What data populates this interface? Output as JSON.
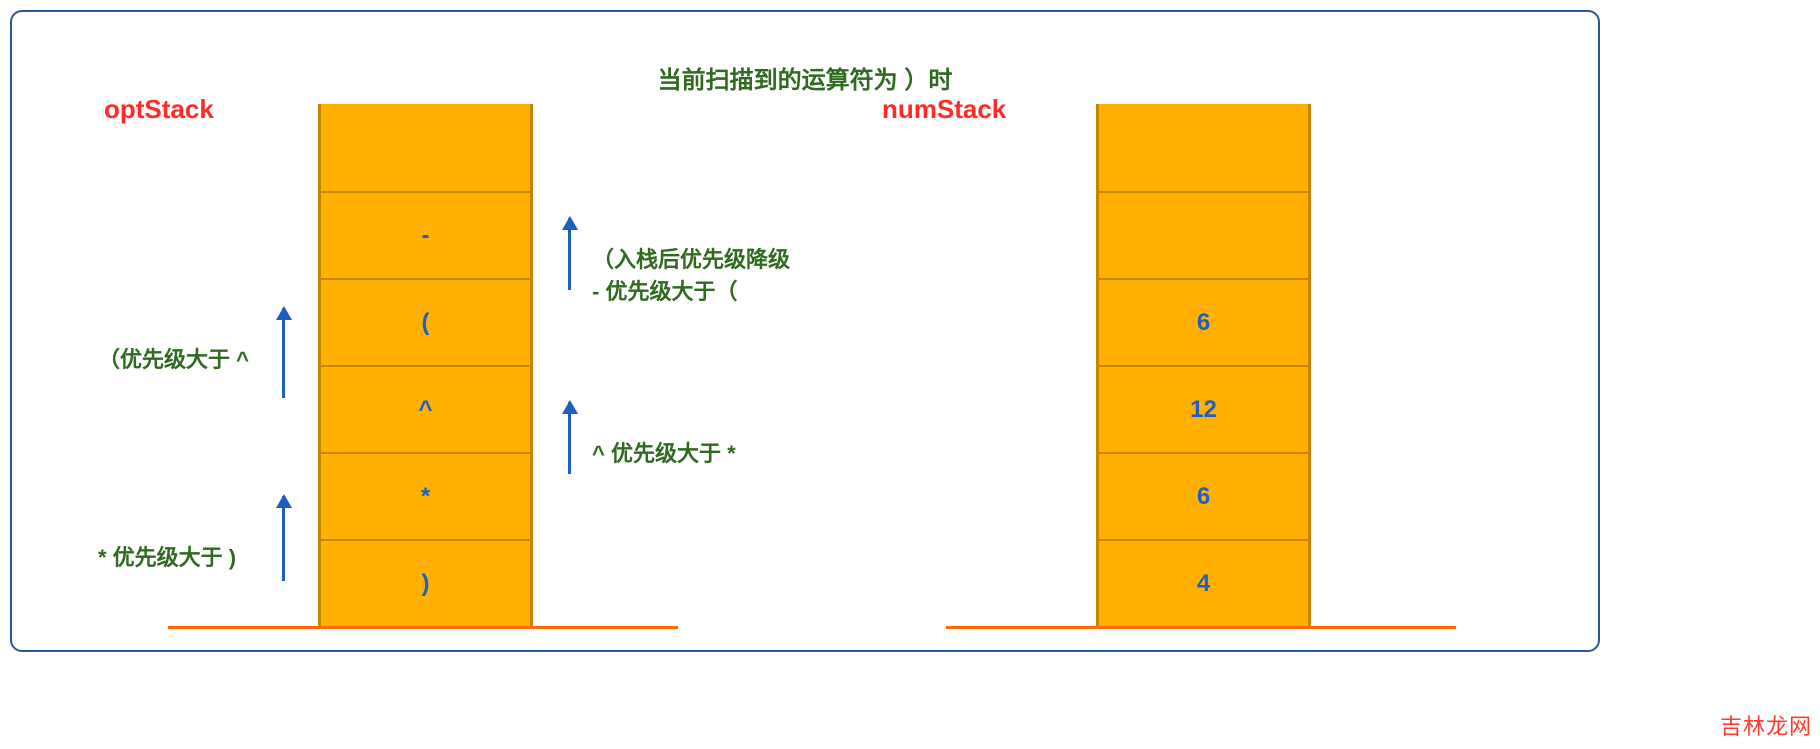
{
  "title": "当前扫描到的运算符为  ）时",
  "optStack": {
    "label": "optStack",
    "cells": [
      "",
      "-",
      "(",
      "^",
      "*",
      ")"
    ]
  },
  "numStack": {
    "label": "numStack",
    "cells": [
      "",
      "",
      "6",
      "12",
      "6",
      "4"
    ]
  },
  "notes": {
    "left_top": "（优先级大于 ^",
    "left_bottom": "* 优先级大于 )",
    "right_top_line1": "（入栈后优先级降级",
    "right_top_line2": "- 优先级大于（",
    "right_bottom": "^ 优先级大于 *"
  },
  "watermark": "吉林龙网",
  "colors": {
    "border": "#2b5797",
    "stack_fill": "#ffb000",
    "stack_border": "#c68400",
    "baseline": "#ff6a00",
    "label_red": "#ff2a2a",
    "note_green": "#2e6b1f",
    "value_blue": "#1e5fbf"
  }
}
